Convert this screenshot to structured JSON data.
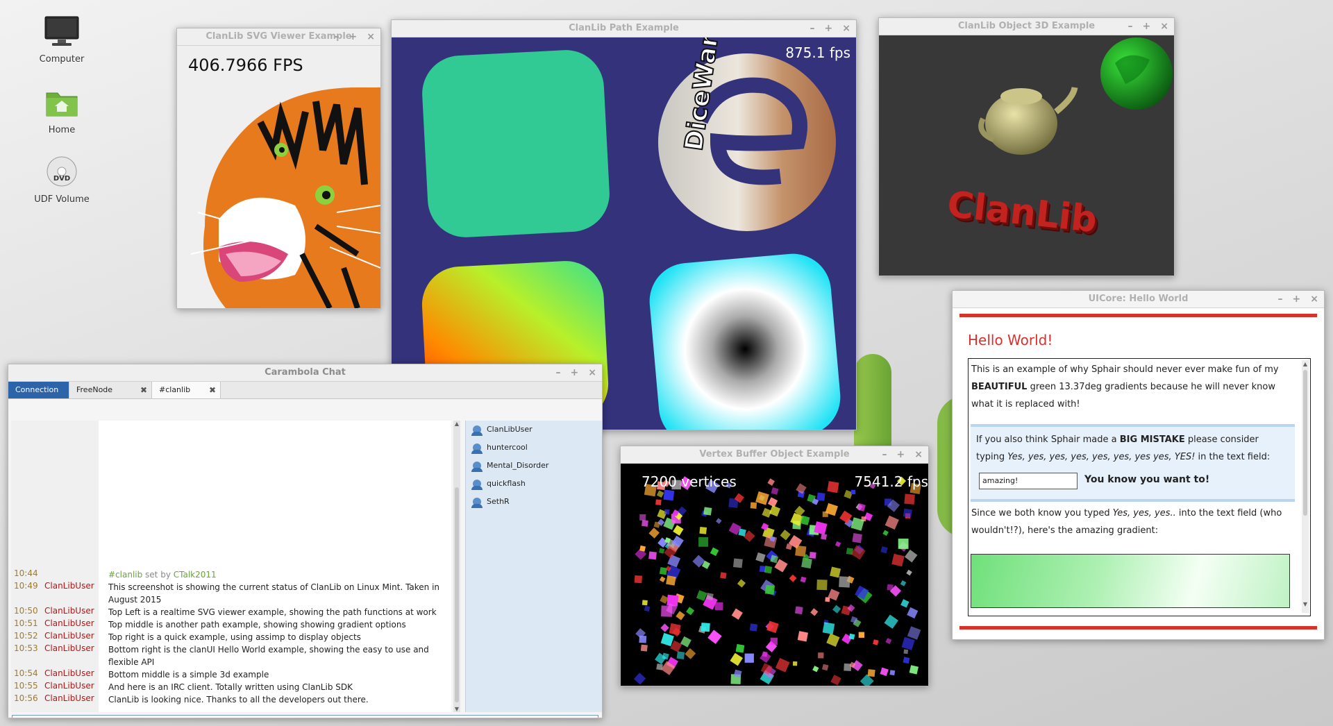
{
  "desktop": {
    "icons": [
      {
        "label": "Computer",
        "icon": "monitor-icon"
      },
      {
        "label": "Home",
        "icon": "home-folder-icon"
      },
      {
        "label": "UDF Volume",
        "icon": "dvd-icon"
      }
    ]
  },
  "window_controls": {
    "minimize": "–",
    "maximize": "+",
    "close": "×"
  },
  "svg_viewer": {
    "title": "ClanLib SVG Viewer Example",
    "fps": "406.7966 FPS"
  },
  "path_example": {
    "title": "ClanLib Path Example",
    "fps": "875.1 fps",
    "logo_text": "DiceWar",
    "logo_glyph": "e"
  },
  "object3d": {
    "title": "ClanLib Object 3D Example",
    "text3d": "ClanLib"
  },
  "vbo": {
    "title": "Vertex Buffer Object Example",
    "vertices": "7200 vertices",
    "fps": "7541.2 fps"
  },
  "hello_world": {
    "title": "UICore: Hello World",
    "heading": "Hello World!",
    "p1": [
      "This is an example of why Sphair should never ever make fun of my ",
      "BEAUTIFUL",
      " green 13.37deg gradients because he will never know what it is replaced with!"
    ],
    "p2": [
      "If you also think Sphair made a ",
      "BIG MISTAKE",
      " please consider typing ",
      "Yes, yes, yes, yes, yes, yes, yes yes, YES!",
      " in the text field:"
    ],
    "input_value": "amazing!",
    "input_side_label": "You know you want to!",
    "p3": [
      "Since we both know you typed ",
      "Yes, yes, yes..",
      " into the text field (who wouldn't!?), here's the amazing gradient:"
    ],
    "colors": {
      "accent": "#d7312c",
      "gradient": "#6fe07a"
    }
  },
  "chat": {
    "title": "Carambola Chat",
    "tabs": [
      {
        "label": "Connection",
        "closable": false
      },
      {
        "label": "FreeNode",
        "closable": true
      },
      {
        "label": "#clanlib",
        "closable": true
      }
    ],
    "topic": {
      "time": "10:44",
      "channel": "#clanlib",
      "set_by": " set by ",
      "user": "CTalk2011"
    },
    "messages": [
      {
        "time": "10:49",
        "nick": "ClanLibUser",
        "text": "This screenshot is showing the current status of ClanLib on Linux Mint.  Taken in August 2015"
      },
      {
        "time": "10:50",
        "nick": "ClanLibUser",
        "text": "Top Left is a realtime SVG viewer example, showing the path functions at work"
      },
      {
        "time": "10:51",
        "nick": "ClanLibUser",
        "text": "Top middle is another path example, showing showing gradient options"
      },
      {
        "time": "10:52",
        "nick": "ClanLibUser",
        "text": "Top right is a quick example, using assimp to display objects"
      },
      {
        "time": "10:53",
        "nick": "ClanLibUser",
        "text": "Bottom right is the clanUI Hello World example, showing the easy to use and flexible API"
      },
      {
        "time": "10:54",
        "nick": "ClanLibUser",
        "text": "Bottom middle is a simple 3d example"
      },
      {
        "time": "10:55",
        "nick": "ClanLibUser",
        "text": "And here is an IRC client. Totally written using ClanLib SDK"
      },
      {
        "time": "10:56",
        "nick": "ClanLibUser",
        "text": "ClanLib is looking nice. Thanks to all the developers out there."
      }
    ],
    "users": [
      "ClanLibUser",
      "huntercool",
      "Mental_Disorder",
      "quickflash",
      "SethR"
    ],
    "input_value": ""
  }
}
